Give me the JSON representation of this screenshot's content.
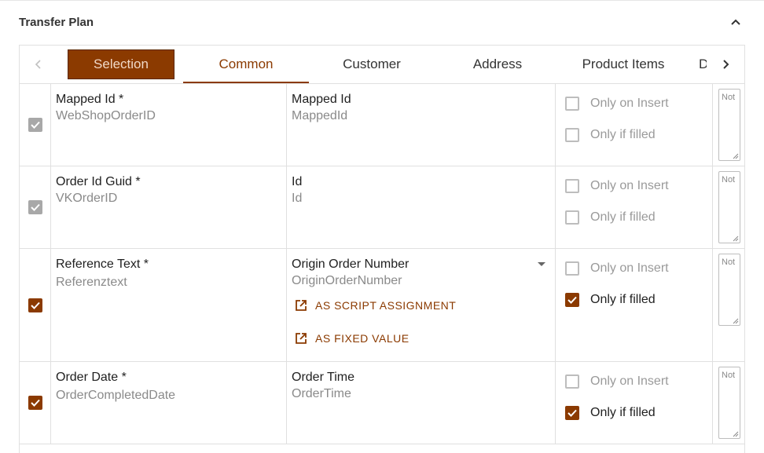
{
  "header": {
    "title": "Transfer Plan"
  },
  "tabs": [
    {
      "label": "Selection"
    },
    {
      "label": "Common"
    },
    {
      "label": "Customer"
    },
    {
      "label": "Address"
    },
    {
      "label": "Product Items"
    },
    {
      "label": "D"
    }
  ],
  "colors": {
    "accent": "#8b3a00",
    "checkbox_disabled": "#a8a8a8"
  },
  "rows": [
    {
      "target_label": "Mapped Id *",
      "target_field": "WebShopOrderID",
      "source_label": "Mapped Id",
      "source_field": "MappedId",
      "opt_insert": "Only on Insert",
      "opt_filled": "Only if filled",
      "note": "Not"
    },
    {
      "target_label": "Order Id Guid *",
      "target_field": "VKOrderID",
      "source_label": "Id",
      "source_field": "Id",
      "opt_insert": "Only on Insert",
      "opt_filled": "Only if filled",
      "note": "Not"
    },
    {
      "target_label": "Reference Text *",
      "target_field": "Referenztext",
      "source_label": "Origin Order Number",
      "source_field": "OriginOrderNumber",
      "script_link": "AS SCRIPT ASSIGNMENT",
      "fixed_link": "AS FIXED VALUE",
      "opt_insert": "Only on Insert",
      "opt_filled": "Only if filled",
      "note": "Not"
    },
    {
      "target_label": "Order Date *",
      "target_field": "OrderCompletedDate",
      "source_label": "Order Time",
      "source_field": "OrderTime",
      "opt_insert": "Only on Insert",
      "opt_filled": "Only if filled",
      "note": "Not"
    }
  ]
}
